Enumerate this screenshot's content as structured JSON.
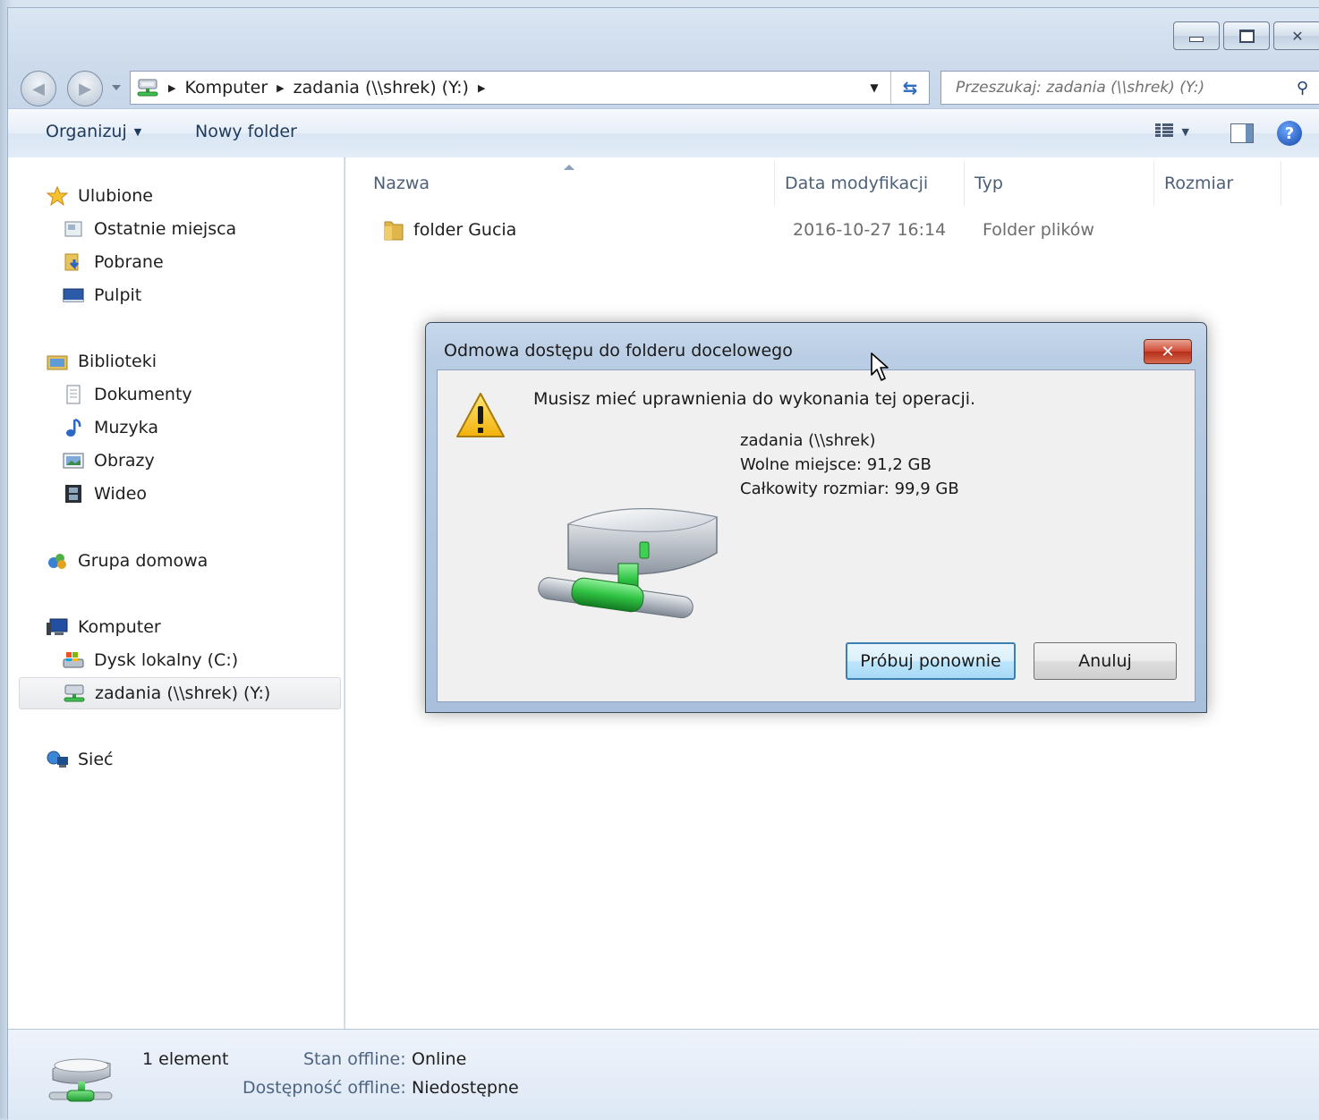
{
  "address_bar": {
    "crumbs": [
      "Komputer",
      "zadania (\\\\shrek) (Y:)"
    ],
    "search_placeholder": "Przeszukaj: zadania (\\\\shrek) (Y:)"
  },
  "toolbar": {
    "organize_label": "Organizuj",
    "new_folder_label": "Nowy folder"
  },
  "sidebar": {
    "favorites": {
      "label": "Ulubione",
      "items": [
        "Ostatnie miejsca",
        "Pobrane",
        "Pulpit"
      ]
    },
    "libraries": {
      "label": "Biblioteki",
      "items": [
        "Dokumenty",
        "Muzyka",
        "Obrazy",
        "Wideo"
      ]
    },
    "homegroup": {
      "label": "Grupa domowa"
    },
    "computer": {
      "label": "Komputer",
      "items": [
        "Dysk lokalny (C:)",
        "zadania (\\\\shrek) (Y:)"
      ],
      "selected": "zadania (\\\\shrek) (Y:)"
    },
    "network": {
      "label": "Sieć"
    }
  },
  "file_list": {
    "columns": [
      "Nazwa",
      "Data modyfikacji",
      "Typ",
      "Rozmiar"
    ],
    "rows": [
      {
        "name": "folder Gucia",
        "modified": "2016-10-27 16:14",
        "type": "Folder plików",
        "size": ""
      }
    ]
  },
  "status_bar": {
    "count": "1 element",
    "offline_status_label": "Stan offline:",
    "offline_status_value": "Online",
    "offline_availability_label": "Dostępność offline:",
    "offline_availability_value": "Niedostępne"
  },
  "dialog": {
    "title": "Odmowa dostępu do folderu docelowego",
    "message": "Musisz mieć uprawnienia do wykonania tej operacji.",
    "drive_name": "zadania (\\\\shrek)",
    "free_space": "Wolne miejsce: 91,2 GB",
    "total_size": "Całkowity rozmiar: 99,9 GB",
    "retry_label": "Próbuj ponownie",
    "cancel_label": "Anuluj"
  },
  "colors": {
    "window_frame": "#c8d7ea",
    "dialog_close": "#cf4a33",
    "default_button_border": "#3c7fb1"
  }
}
